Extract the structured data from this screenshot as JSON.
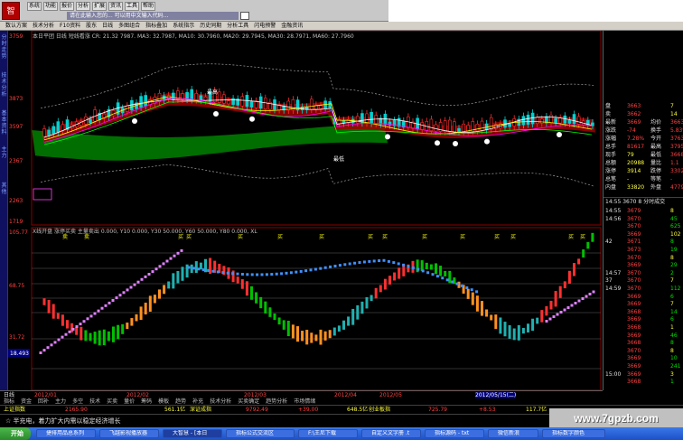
{
  "app": {
    "search_placeholder": "请在此输入您的... 可以用中文输入代码...",
    "top_buttons": [
      "系统",
      "功能",
      "报价",
      "分析",
      "扩展",
      "资讯",
      "工具",
      "帮助"
    ],
    "menu": [
      "数认方案",
      "技术分析",
      "F10资料",
      "股东",
      "日线",
      "多图组合",
      "指标叠加",
      "系统指示",
      "历史同期",
      "分析工具",
      "闪电预警",
      "金融资讯"
    ],
    "left_tabs": [
      "分时走势",
      "技术分析",
      "基本资料",
      "主力",
      "其他"
    ]
  },
  "chart": {
    "info_line": "本日平团 日线 短线看涨 CR: 21.32 7987.  MA3: 32.7987, MA10: 30.7960, MA20: 29.7945, MA30: 28.7971, MA60: 27.7960",
    "indicator_line": "X线开盘  涨停买卖  主量卖出 0.000, Y10 0.000, Y30 50.000, Y60 50.000, Y80 0.000, XL",
    "y_upper": [
      "3759",
      "3873",
      "3597",
      "2367",
      "2263",
      "1719"
    ],
    "y_lower": [
      "105.77",
      "68.75",
      "31.72",
      "18.493"
    ],
    "labels": {
      "top_note": "最高",
      "bottom_note": "最低",
      "buy": "买",
      "sell": "卖"
    },
    "x_dates": [
      "2012/01",
      "2012/02",
      "2012/03",
      "2012/04",
      "2012/05",
      "2012/05/15(二)"
    ],
    "period_label": "日线",
    "bottom_tabs": [
      "指标",
      "资金",
      "回补",
      "主力",
      "多空",
      "技术",
      "买卖",
      "量价",
      "筹码",
      "模板",
      "趋势",
      "补充",
      "技术分析",
      "买卖确定",
      "趋势分析",
      "市场情绪"
    ]
  },
  "panel": {
    "header": {
      "label1": "盘",
      "val1": "3663",
      "val2": "7"
    },
    "rows": [
      {
        "l": "卖",
        "a": "3662",
        "b": "14"
      },
      {
        "l": "最新",
        "a": "3669",
        "b": "均价",
        "c": "3663"
      },
      {
        "l": "涨跌",
        "a": "-74",
        "b": "换手",
        "c": "5.83%"
      },
      {
        "l": "涨幅",
        "a": "7.28%",
        "b": "今开",
        "c": "3763"
      },
      {
        "l": "总手",
        "a": "81617",
        "b": "最高",
        "c": "3795"
      },
      {
        "l": "现手",
        "a": "79",
        "b": "最低",
        "c": "3668"
      },
      {
        "l": "总额",
        "a": "20988",
        "b": "量比",
        "c": "1.1"
      },
      {
        "l": "涨停",
        "a": "3914",
        "b": "跌停",
        "c": "3302"
      },
      {
        "l": "总笔",
        "a": "-",
        "b": "等笔",
        "c": "-"
      },
      {
        "l": "内盘",
        "a": "33820",
        "b": "外盘",
        "c": "47797"
      }
    ],
    "time_header": "14:55  3670  8  分时成交",
    "ticks": [
      {
        "t": "14:55",
        "p": "3679",
        "v": "8"
      },
      {
        "t": "14:56",
        "p": "3670",
        "v": "45"
      },
      {
        "t": "",
        "p": "3670",
        "v": "625"
      },
      {
        "t": "",
        "p": "3669",
        "v": "102"
      },
      {
        "t": "42",
        "p": "3671",
        "v": "8"
      },
      {
        "t": "",
        "p": "3673",
        "v": "19"
      },
      {
        "t": "",
        "p": "3670",
        "v": "8"
      },
      {
        "t": "",
        "p": "3669",
        "v": "29"
      },
      {
        "t": "14:57",
        "p": "3670",
        "v": "2"
      },
      {
        "t": "37",
        "p": "3670",
        "v": "7"
      },
      {
        "t": "14:59",
        "p": "3670",
        "v": "112"
      },
      {
        "t": "",
        "p": "3669",
        "v": "6"
      },
      {
        "t": "",
        "p": "3669",
        "v": "7"
      },
      {
        "t": "",
        "p": "3668",
        "v": "14"
      },
      {
        "t": "",
        "p": "3669",
        "v": "6"
      },
      {
        "t": "",
        "p": "3668",
        "v": "1"
      },
      {
        "t": "",
        "p": "3669",
        "v": "46"
      },
      {
        "t": "",
        "p": "3668",
        "v": "8"
      },
      {
        "t": "",
        "p": "3670",
        "v": "8"
      },
      {
        "t": "",
        "p": "3669",
        "v": "10"
      },
      {
        "t": "",
        "p": "3669",
        "v": "241"
      },
      {
        "t": "15:00",
        "p": "3669",
        "v": "3"
      },
      {
        "t": "",
        "p": "3668",
        "v": "1"
      }
    ]
  },
  "ticker": {
    "name": "上证指数",
    "val1": "2165.90",
    "chg1": "561.1亿",
    "name2": "深证成指",
    "val2": "9792.49",
    "chg2": "+39.00",
    "amt2": "648.5亿",
    "name3": "创业板指",
    "val3": "725.79",
    "chg3": "+8.53",
    "amt3": "117.7亿"
  },
  "news": "☆ 半充电，着力扩大内需以稳定经济增长",
  "watermark": "www.7gpzb.com",
  "taskbar": {
    "start": "开始",
    "tasks": [
      "捷排用品总系列",
      "飞越影视播放器",
      "大智慧 - [本日",
      "指标公式交流区",
      "F:\\王尼下载",
      "自定义文字册 .t",
      "指标源码 - txt",
      "微信新浪",
      "指标数字颜色"
    ]
  }
}
